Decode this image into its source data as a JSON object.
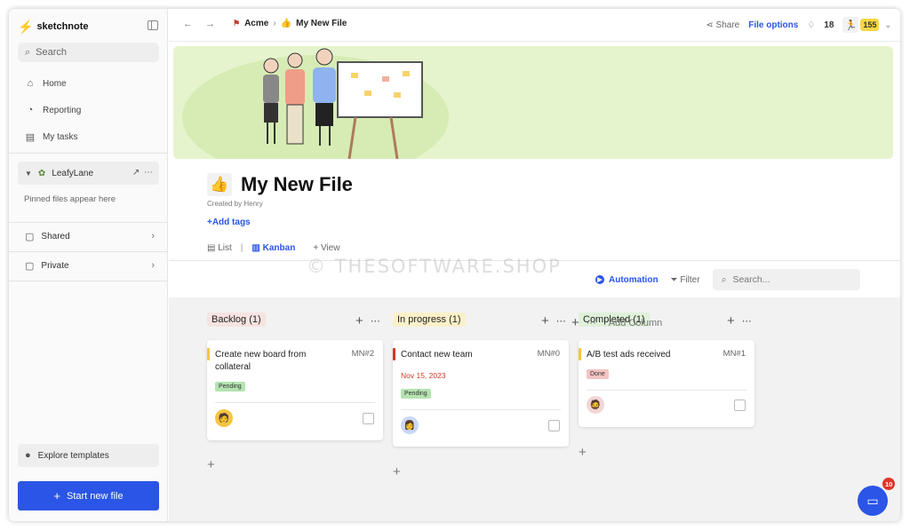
{
  "sidebar": {
    "brand": "sketchnote",
    "search_placeholder": "Search",
    "nav": [
      {
        "label": "Home",
        "icon": "home-icon"
      },
      {
        "label": "Reporting",
        "icon": "pie-chart-icon"
      },
      {
        "label": "My tasks",
        "icon": "clipboard-icon"
      }
    ],
    "workspace": {
      "name": "LeafyLane"
    },
    "pinned_hint": "Pinned files appear here",
    "sections": [
      {
        "label": "Shared",
        "icon": "shared-doc-icon"
      },
      {
        "label": "Private",
        "icon": "lock-doc-icon"
      }
    ],
    "explore": "Explore templates",
    "start_button": "Start new file"
  },
  "topbar": {
    "breadcrumb": [
      "Acme",
      "My New File"
    ],
    "share": "Share",
    "file_options": "File options",
    "notifications": "18",
    "points": "155"
  },
  "file": {
    "title": "My New File",
    "created_by": "Created by Henry",
    "add_tags": "+Add tags"
  },
  "views": {
    "list": "List",
    "kanban": "Kanban",
    "view": "View"
  },
  "toolbar": {
    "automation": "Automation",
    "filter": "Filter",
    "search_placeholder": "Search..."
  },
  "watermark": "© THESOFTWARE.SHOP",
  "board": {
    "columns": [
      {
        "label": "Backlog (1)",
        "color": "#f7e3e0",
        "cards": [
          {
            "title": "Create new board from collateral",
            "id": "MN#2",
            "status": "Pending",
            "status_color": "#b5e3b1",
            "accent": "#f5c542"
          }
        ]
      },
      {
        "label": "In progress (1)",
        "color": "#fbf0c9",
        "cards": [
          {
            "title": "Contact new team",
            "id": "MN#0",
            "date": "Nov 15, 2023",
            "status": "Pending",
            "status_color": "#b5e3b1",
            "accent": "#d23a2a"
          }
        ]
      },
      {
        "label": "Completed (1)",
        "color": "#dff1d9",
        "cards": [
          {
            "title": "A/B test ads received",
            "id": "MN#1",
            "status": "Done",
            "status_color": "#f5c3c3",
            "accent": "#f5c542"
          }
        ]
      }
    ],
    "add_column": "Add Column"
  },
  "chat": {
    "badge": "10"
  },
  "colors": {
    "accent": "#2b55e6",
    "banner": "#e6f4cd",
    "board_bg": "#f2f2f2"
  }
}
